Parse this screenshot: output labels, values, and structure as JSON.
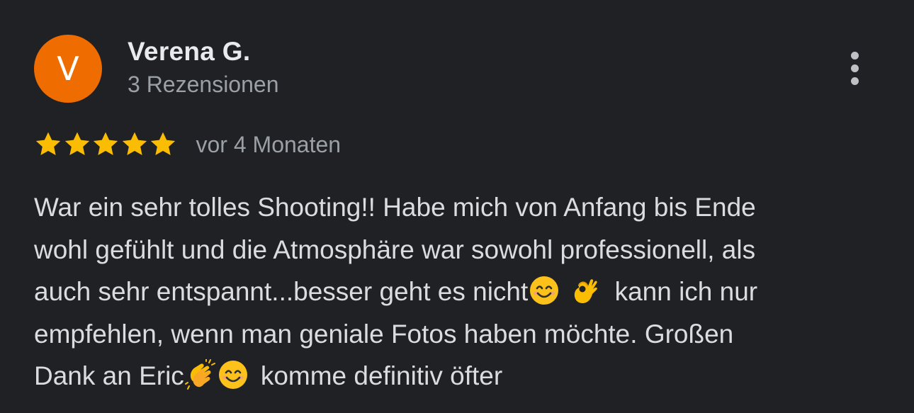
{
  "review": {
    "avatar_letter": "V",
    "avatar_color": "#ef6c00",
    "reviewer_name": "Verena G.",
    "reviewer_meta": "3 Rezensionen",
    "rating": 5,
    "rating_max": 5,
    "star_color": "#fbbc04",
    "date": "vor 4 Monaten",
    "more_icon": "more-vert-icon",
    "text": {
      "line1": "War ein sehr tolles Shooting!! Habe mich von Anfang bis Ende",
      "line2": "wohl gefühlt und die Atmosphäre war sowohl professionell, als",
      "line3_before": "auch sehr entspannt...besser geht es nicht",
      "line3_after": "kann ich nur",
      "line4": "empfehlen, wenn man geniale Fotos haben möchte. Großen",
      "line5_before": "Dank an Eric",
      "line5_after": "komme definitiv öfter"
    },
    "emojis": [
      "smiling-face-icon",
      "ok-hand-icon",
      "clapping-hands-icon",
      "smiling-face-icon"
    ]
  }
}
